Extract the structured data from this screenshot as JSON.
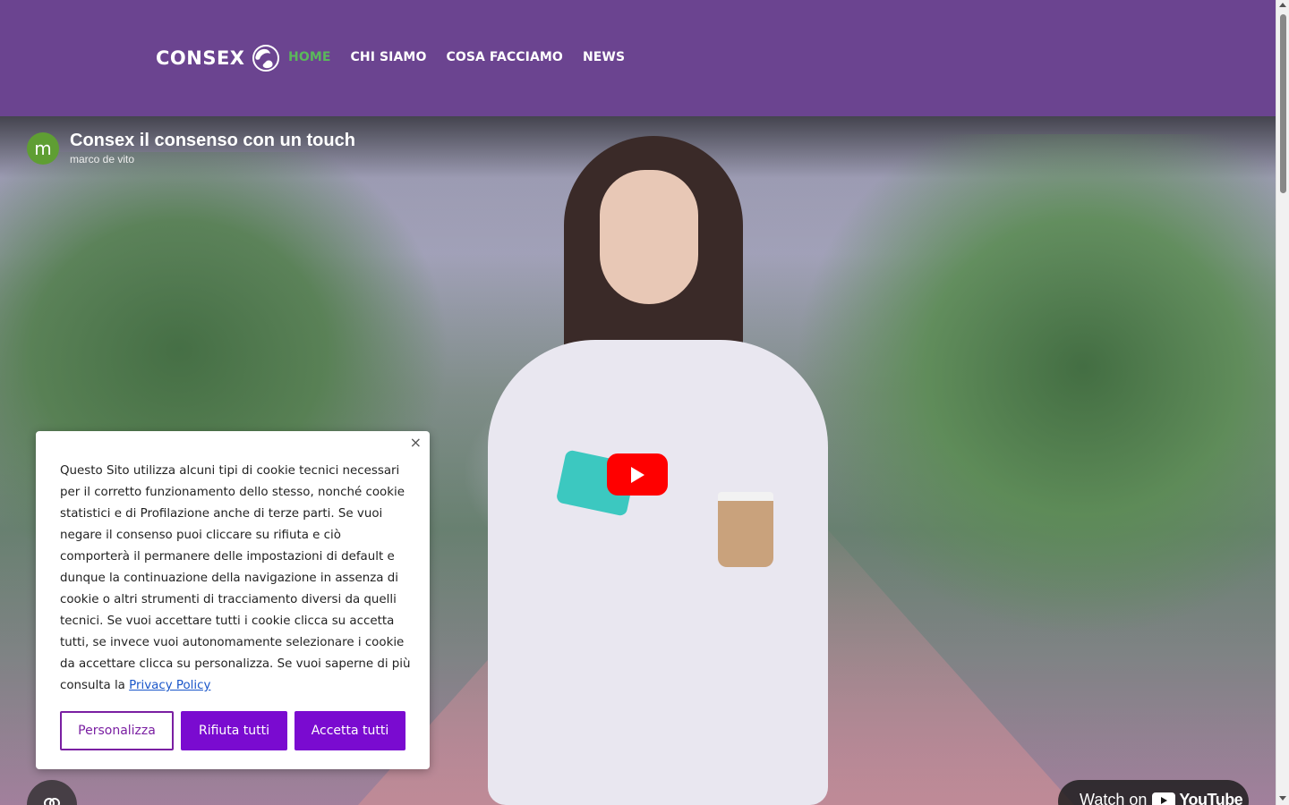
{
  "header": {
    "logo_text": "CONSEX",
    "nav": [
      {
        "label": "HOME",
        "active": true
      },
      {
        "label": "CHI SIAMO",
        "active": false
      },
      {
        "label": "COSA FACCIAMO",
        "active": false
      },
      {
        "label": "NEWS",
        "active": false
      }
    ],
    "background": "#6b4490",
    "active_color": "#5bb85b"
  },
  "video": {
    "avatar_letter": "m",
    "title": "Consex il consenso con un touch",
    "channel": "marco de vito",
    "watch_on": "Watch on",
    "youtube": "YouTube"
  },
  "cookie": {
    "text": "Questo Sito utilizza alcuni tipi di cookie tecnici necessari per il corretto funzionamento dello stesso, nonché cookie statistici e di Profilazione anche di terze parti. Se vuoi negare il consenso puoi cliccare su rifiuta e ciò comporterà il permanere delle impostazioni di default e dunque la continuazione della navigazione in assenza di cookie o altri strumenti di tracciamento diversi da quelli tecnici. Se vuoi accettare tutti i cookie clicca su accetta tutti, se invece vuoi autonomamente selezionare i cookie da accettare clicca su personalizza. Se vuoi saperne di più consulta la",
    "privacy_link": "Privacy Policy",
    "close_symbol": "×",
    "buttons": {
      "customize": "Personalizza",
      "reject": "Rifiuta tutti",
      "accept": "Accetta tutti"
    },
    "accent": "#7a0bd0"
  }
}
